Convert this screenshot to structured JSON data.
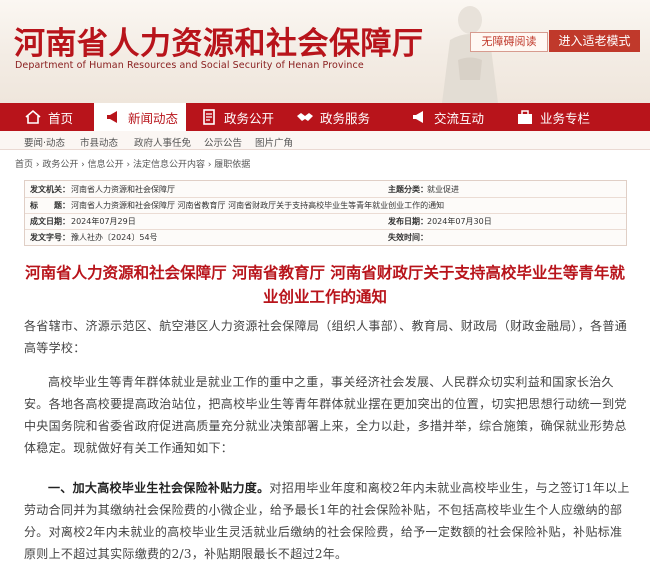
{
  "banner": {
    "title": "河南省人力资源和社会保障厅",
    "subtitle": "Department of Human Resources and Social Security of Henan Province",
    "accessibility_btn": "无障碍阅读",
    "elder_mode_btn": "进入适老模式"
  },
  "nav": [
    {
      "label": "首页",
      "icon": "home-icon"
    },
    {
      "label": "新闻动态",
      "icon": "megaphone-icon"
    },
    {
      "label": "政务公开",
      "icon": "document-icon"
    },
    {
      "label": "政务服务",
      "icon": "handshake-icon"
    },
    {
      "label": "交流互动",
      "icon": "megaphone-icon"
    },
    {
      "label": "业务专栏",
      "icon": "briefcase-icon"
    }
  ],
  "subnav": [
    "要闻·动态",
    "市县动态",
    "政府人事任免",
    "公示公告",
    "图片广角"
  ],
  "breadcrumb": "首页 › 政务公开 › 信息公开 › 法定信息公开内容 › 履职依据",
  "meta": {
    "issuer_label": "发文机关：",
    "issuer_value": "河南省人力资源和社会保障厅",
    "topic_label": "主题分类：",
    "topic_value": "就业促进",
    "title_label": "标　　题：",
    "title_value": "河南省人力资源和社会保障厅 河南省教育厅 河南省财政厅关于支持高校毕业生等青年就业创业工作的通知",
    "date_label": "成文日期：",
    "date_value": "2024年07月29日",
    "pub_label": "发布日期：",
    "pub_value": "2024年07月30日",
    "no_label": "发文字号：",
    "no_value": "豫人社办〔2024〕54号",
    "valid_label": "失效时间："
  },
  "article": {
    "title_line1": "河南省人力资源和社会保障厅 河南省教育厅 河南省财政厅关于支持高校毕业生等青年就",
    "title_line2": "业创业工作的通知",
    "p1": "各省辖市、济源示范区、航空港区人力资源社会保障局（组织人事部）、教育局、财政局（财政金融局），各普通高等学校：",
    "p2": "高校毕业生等青年群体就业是就业工作的重中之重，事关经济社会发展、人民群众切实利益和国家长治久安。各地各高校要提高政治站位，把高校毕业生等青年群体就业摆在更加突出的位置，切实把思想行动统一到党中央国务院和省委省政府促进高质量充分就业决策部署上来，全力以赴，多措并举，综合施策，确保就业形势总体稳定。现就做好有关工作通知如下：",
    "p3_bold": "一、加大高校毕业生社会保险补贴力度。",
    "p3": "对招用毕业年度和离校2年内未就业高校毕业生，与之签订1年以上劳动合同并为其缴纳社会保险费的小微企业，给予最长1年的社会保险补贴，不包括高校毕业生个人应缴纳的部分。对离校2年内未就业的高校毕业生灵活就业后缴纳的社会保险费，给予一定数额的社会保险补贴，补贴标准原则上不超过其实际缴费的2/3，补贴期限最长不超过2年。"
  }
}
